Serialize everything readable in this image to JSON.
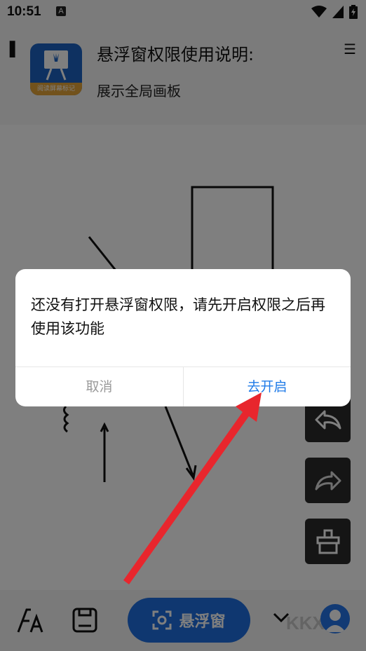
{
  "status_bar": {
    "time": "10:51",
    "notif_letter": "A"
  },
  "header": {
    "title": "悬浮窗权限使用说明:",
    "subtitle": "展示全局画板",
    "icon_ribbon": "阅读屏幕标记"
  },
  "toolbar": {
    "font_icon_text": "A",
    "float_button_label": "悬浮窗"
  },
  "watermark": "KKX",
  "dialog": {
    "message": "还没有打开悬浮窗权限，请先开启权限之后再使用该功能",
    "cancel_label": "取消",
    "confirm_label": "去开启"
  },
  "colors": {
    "accent": "#1f6fe0",
    "dialog_confirm": "#1f7be8",
    "annotation_arrow": "#e8262d"
  },
  "icons": [
    "signal-icon",
    "wifi-icon",
    "battery-icon",
    "undo-icon",
    "redo-icon",
    "eraser-icon",
    "font-icon",
    "save-icon",
    "screenshot-icon",
    "chevron-down-icon",
    "avatar-icon"
  ]
}
